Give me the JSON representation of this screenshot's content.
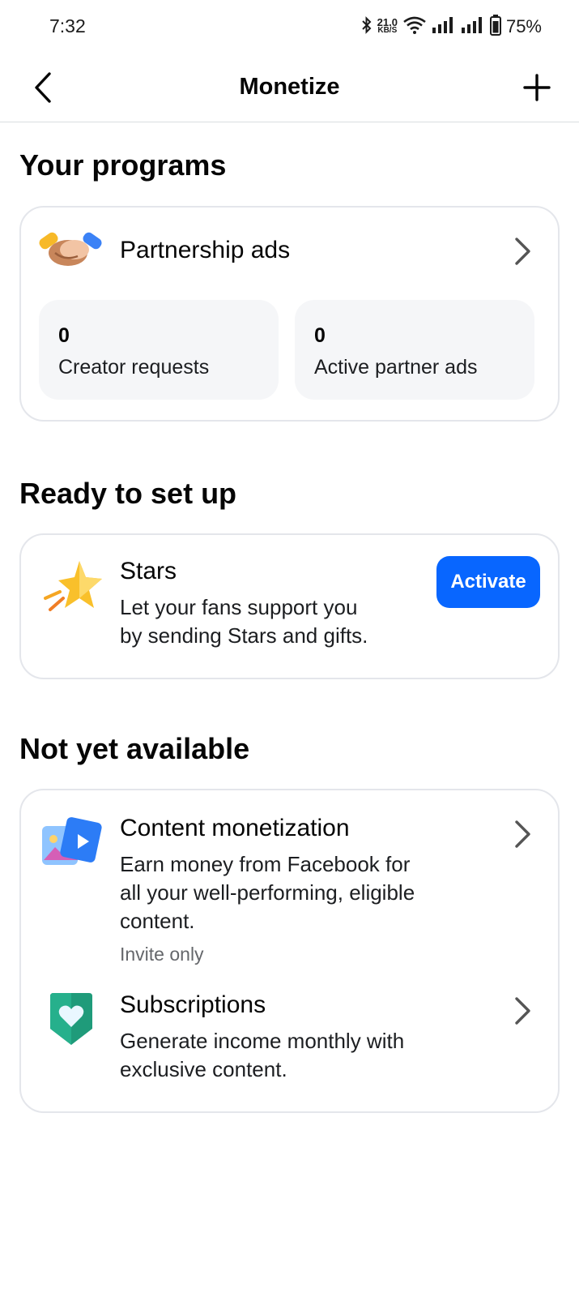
{
  "status_bar": {
    "time": "7:32",
    "net_speed_value": "21.0",
    "net_speed_unit": "KB/S",
    "battery": "75%"
  },
  "header": {
    "title": "Monetize"
  },
  "sections": {
    "your_programs": "Your programs",
    "ready": "Ready to set up",
    "not_available": "Not yet available"
  },
  "partnership": {
    "title": "Partnership ads",
    "stats": [
      {
        "value": "0",
        "label": "Creator requests"
      },
      {
        "value": "0",
        "label": "Active partner ads"
      }
    ]
  },
  "stars": {
    "title": "Stars",
    "desc_line1": "Let your fans support you",
    "desc_line2": "by sending Stars and gifts.",
    "button": "Activate"
  },
  "content_monetization": {
    "title": "Content monetization",
    "desc_line1": "Earn money from Facebook for",
    "desc_line2": "all your well-performing, eligible",
    "desc_line3": "content.",
    "note": "Invite only"
  },
  "subscriptions": {
    "title": "Subscriptions",
    "desc_line1": "Generate income monthly with",
    "desc_line2": "exclusive content."
  },
  "colors": {
    "accent": "#0866ff",
    "card_border": "#e4e6eb",
    "stat_bg": "#f5f6f8",
    "secondary_text": "#65676b"
  },
  "icons": [
    "back-arrow-icon",
    "plus-icon",
    "handshake-icon",
    "star-icon",
    "video-photo-icon",
    "heart-shield-icon",
    "chevron-right-icon",
    "bluetooth-icon",
    "wifi-icon",
    "signal-icon",
    "battery-icon"
  ]
}
